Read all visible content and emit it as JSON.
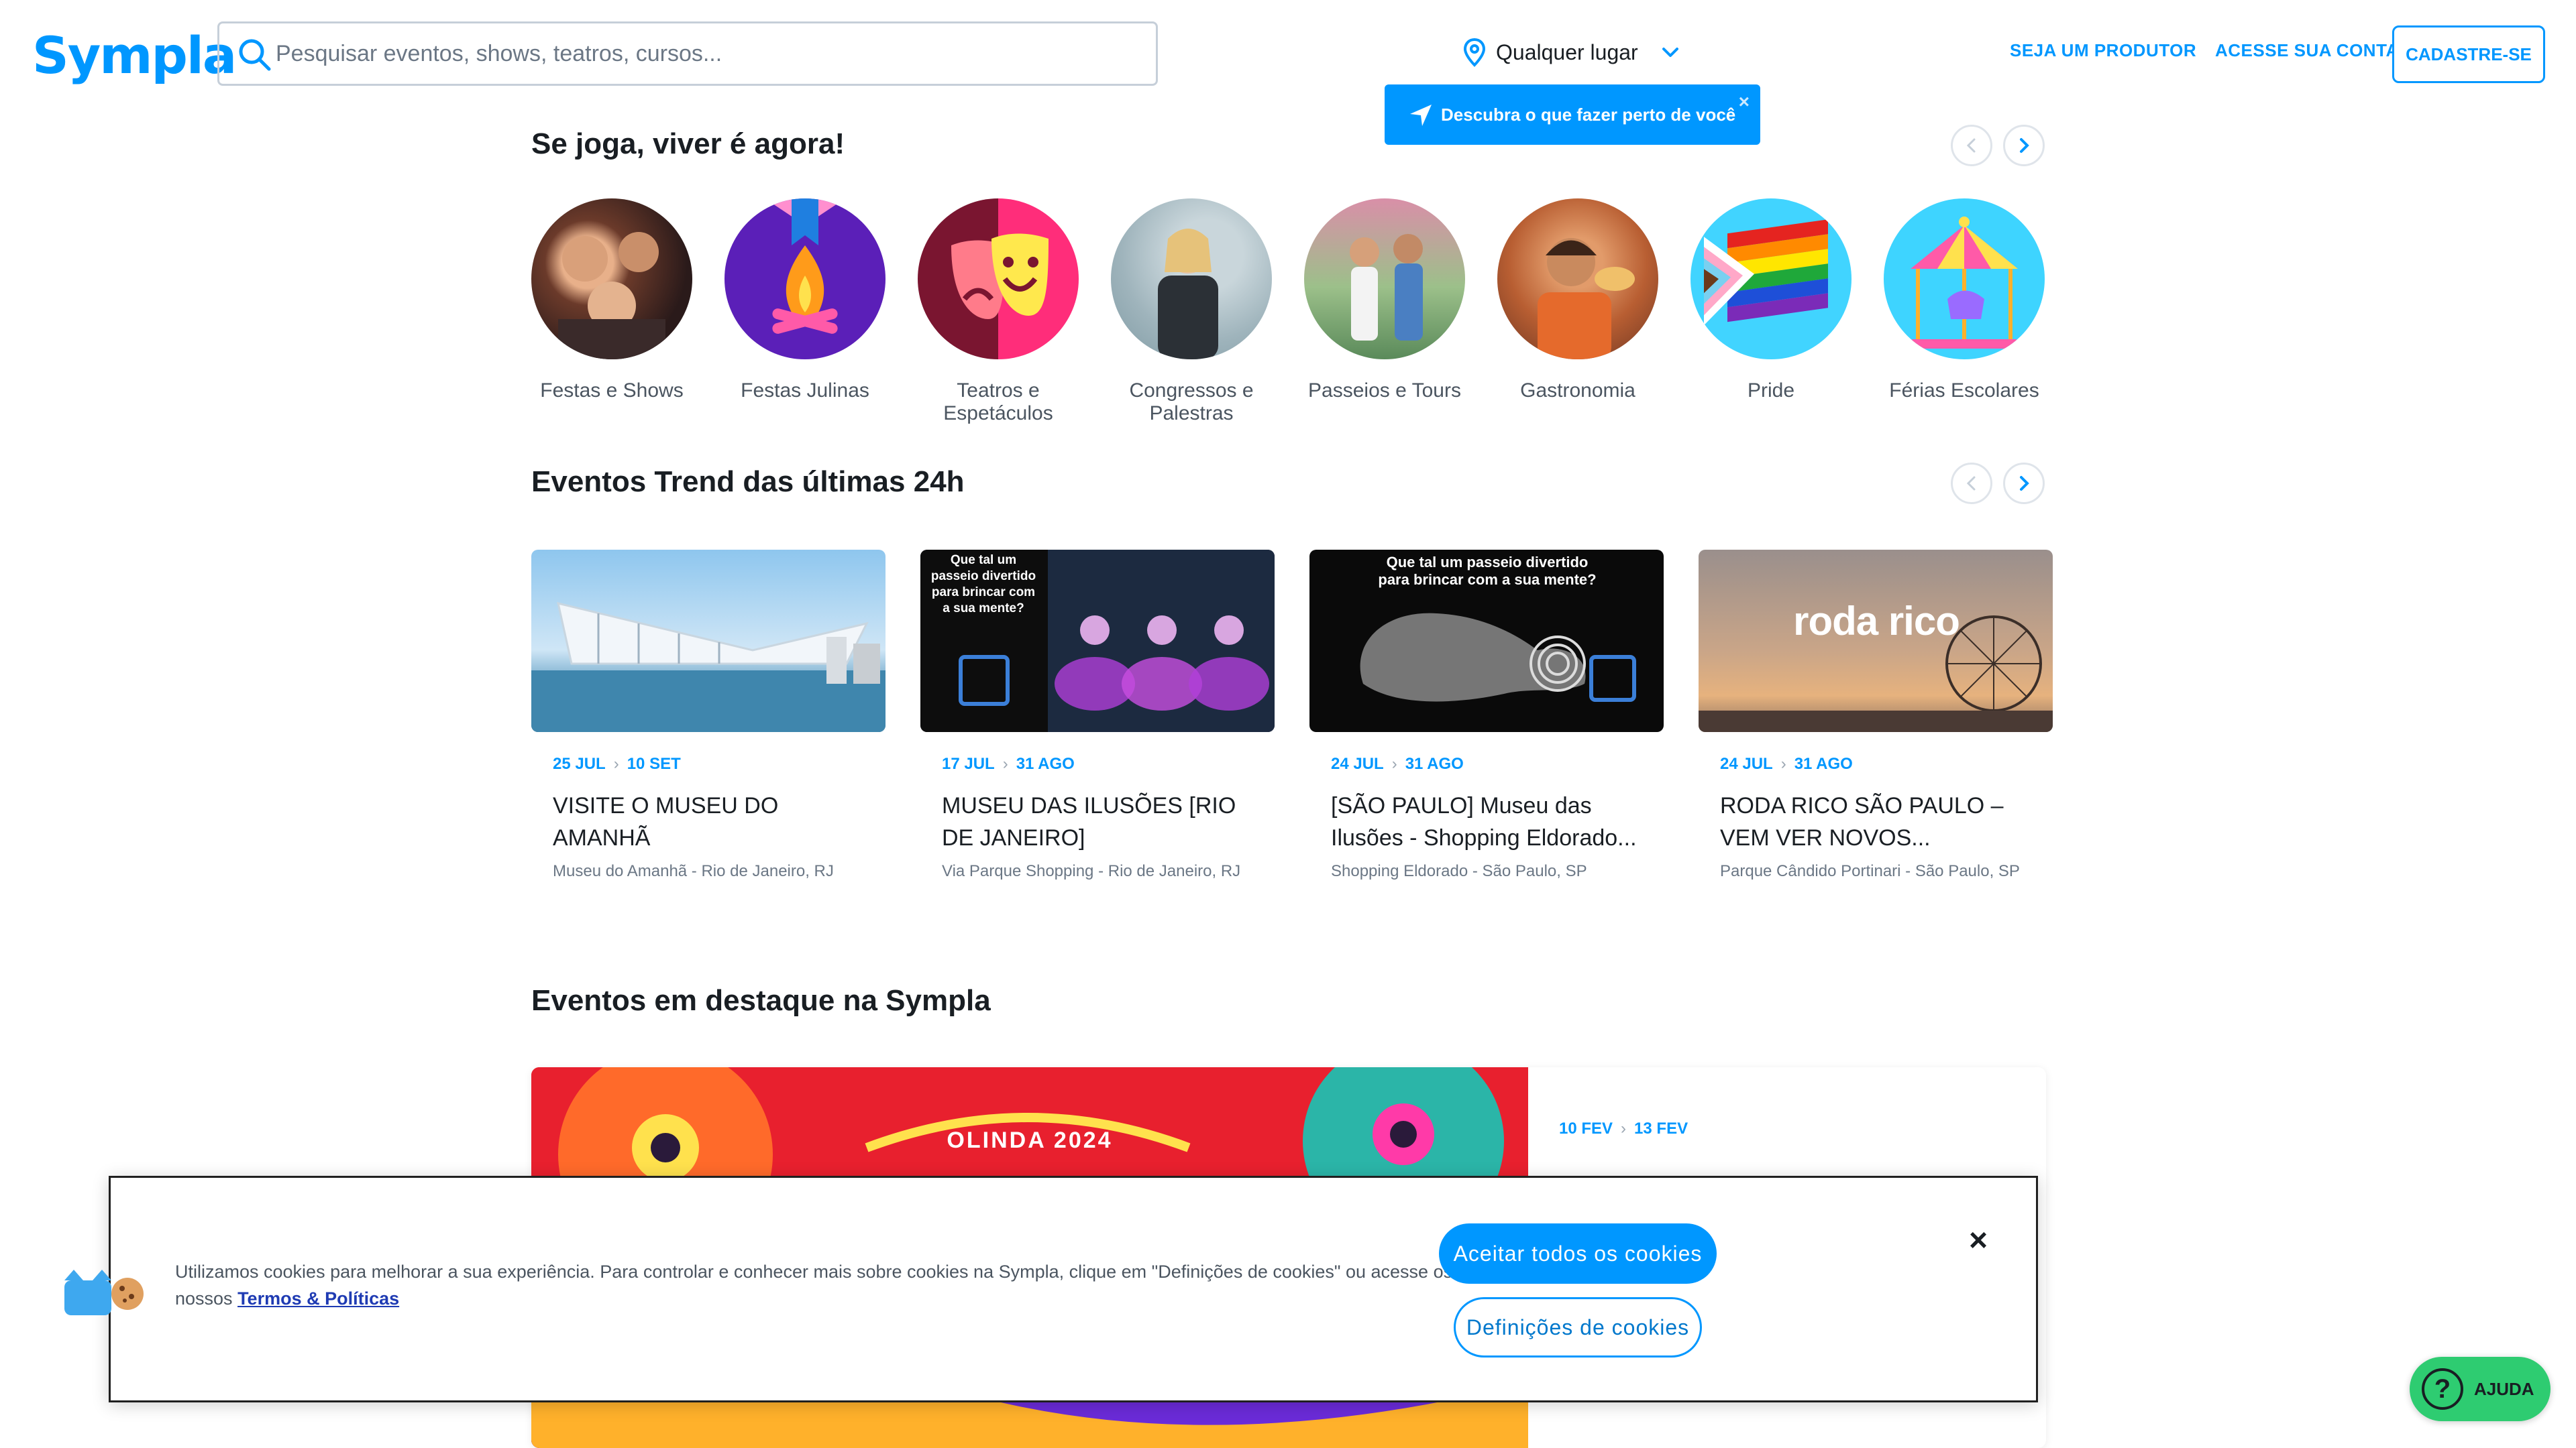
{
  "header": {
    "logo": "Sympla",
    "search_placeholder": "Pesquisar eventos, shows, teatros, cursos...",
    "location": "Qualquer lugar",
    "tooltip": "Descubra o que fazer perto de você",
    "tooltip_close": "×",
    "nav": {
      "produtor": "SEJA UM PRODUTOR",
      "conta": "ACESSE SUA CONTA",
      "cadastro": "CADASTRE-SE"
    }
  },
  "categories_section": {
    "title": "Se joga, viver é agora!",
    "items": [
      {
        "label": "Festas e Shows"
      },
      {
        "label": "Festas Julinas"
      },
      {
        "label": "Teatros e Espetáculos"
      },
      {
        "label": "Congressos e Palestras"
      },
      {
        "label": "Passeios e Tours"
      },
      {
        "label": "Gastronomia"
      },
      {
        "label": "Pride"
      },
      {
        "label": "Férias Escolares"
      }
    ]
  },
  "trend_section": {
    "title": "Eventos Trend das últimas 24h",
    "cards": [
      {
        "start": "25 JUL",
        "end": "10 SET",
        "title": "VISITE O MUSEU DO AMANHÃ",
        "location": "Museu do Amanhã - Rio de Janeiro, RJ",
        "image_text": ""
      },
      {
        "start": "17 JUL",
        "end": "31 AGO",
        "title": "MUSEU DAS ILUSÕES [RIO DE JANEIRO]",
        "location": "Via Parque Shopping - Rio de Janeiro, RJ",
        "image_text": "Que tal um passeio divertido para brincar com a sua mente?"
      },
      {
        "start": "24 JUL",
        "end": "31 AGO",
        "title": "[SÃO PAULO] Museu das Ilusões - Shopping Eldorado...",
        "location": "Shopping Eldorado - São Paulo, SP",
        "image_text": "Que tal um passeio divertido para brincar com a sua mente?"
      },
      {
        "start": "24 JUL",
        "end": "31 AGO",
        "title": "RODA RICO SÃO PAULO – VEM VER NOVOS...",
        "location": "Parque Cândido Portinari - São Paulo, SP",
        "image_text": "roda rico"
      }
    ]
  },
  "featured_section": {
    "title": "Eventos em destaque na Sympla",
    "start": "10 FEV",
    "end": "13 FEV",
    "image_text": "OLINDA 2024"
  },
  "cookie_banner": {
    "text": "Utilizamos cookies para melhorar a sua experiência. Para controlar e conhecer mais sobre cookies na Sympla, clique em \"Definições de cookies\" ou acesse os nossos ",
    "link": "Termos & Políticas",
    "accept": "Aceitar todos os cookies",
    "settings": "Definições de cookies",
    "close": "×"
  },
  "help": {
    "label": "AJUDA",
    "icon_glyph": "?"
  },
  "colors": {
    "brand": "#0097ff",
    "help": "#2ecc71"
  }
}
